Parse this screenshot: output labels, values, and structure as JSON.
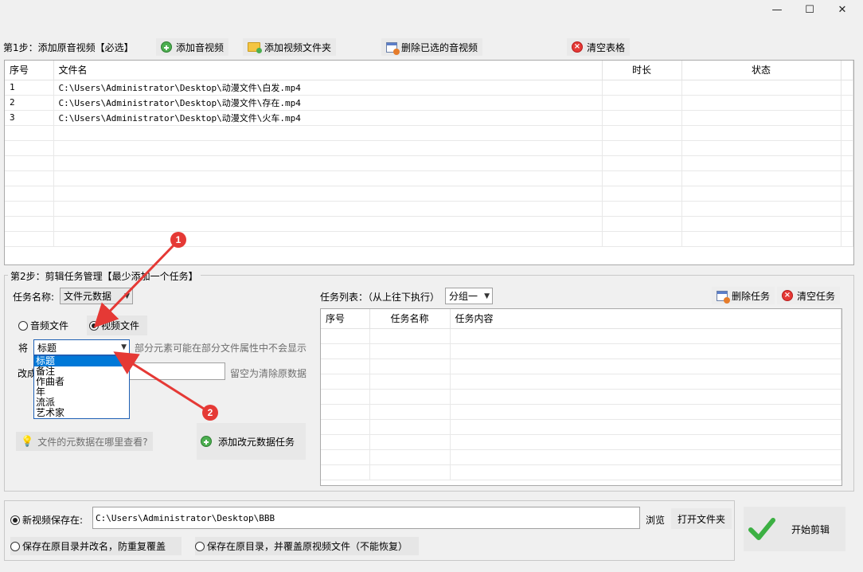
{
  "window": {
    "minimize_glyph": "—",
    "maximize_glyph": "☐",
    "close_glyph": "✕"
  },
  "step1": {
    "label": "第1步：添加原音视频【必选】",
    "add_audio_label": "添加音视频",
    "add_folder_label": "添加视频文件夹",
    "delete_selected_label": "删除已选的音视频",
    "clear_table_label": "清空表格"
  },
  "file_table": {
    "headers": {
      "index": "序号",
      "filename": "文件名",
      "duration": "时长",
      "status": "状态"
    },
    "rows": [
      {
        "index": "1",
        "filename": "C:\\Users\\Administrator\\Desktop\\动漫文件\\白发.mp4",
        "duration": "",
        "status": ""
      },
      {
        "index": "2",
        "filename": "C:\\Users\\Administrator\\Desktop\\动漫文件\\存在.mp4",
        "duration": "",
        "status": ""
      },
      {
        "index": "3",
        "filename": "C:\\Users\\Administrator\\Desktop\\动漫文件\\火车.mp4",
        "duration": "",
        "status": ""
      }
    ]
  },
  "step2": {
    "label": "第2步：剪辑任务管理【最少添加一个任务】",
    "task_name_label": "任务名称:",
    "task_name_value": "文件元数据",
    "radio_audio": "音频文件",
    "radio_video": "视频文件",
    "jiang_label": "将",
    "field_select_value": "标题",
    "field_hint": "部分元素可能在部分文件属性中不会显示",
    "change_to_label": "改成",
    "change_to_value": "",
    "change_hint": "留空为清除原数据",
    "dropdown_options": [
      "标题",
      "备注",
      "作曲者",
      "年",
      "流派",
      "艺术家"
    ],
    "metadata_help": "文件的元数据在哪里查看?",
    "add_task_label": "添加改元数据任务",
    "task_list_label": "任务列表：（从上往下执行）",
    "group_select_value": "分组一",
    "delete_task_label": "删除任务",
    "clear_tasks_label": "清空任务",
    "task_headers": {
      "index": "序号",
      "name": "任务名称",
      "content": "任务内容"
    }
  },
  "annotations": {
    "badge1": "1",
    "badge2": "2"
  },
  "output": {
    "new_save_label": "新视频保存在:",
    "save_path": "C:\\Users\\Administrator\\Desktop\\BBB",
    "browse_label": "浏览",
    "open_folder_label": "打开文件夹",
    "save_rename_label": "保存在原目录并改名，防重复覆盖",
    "save_overwrite_label": "保存在原目录，并覆盖原视频文件（不能恢复）",
    "start_label": "开始剪辑"
  },
  "colors": {
    "accent": "#0078d7",
    "annotation": "#e53935",
    "start_check": "#3cb043"
  }
}
